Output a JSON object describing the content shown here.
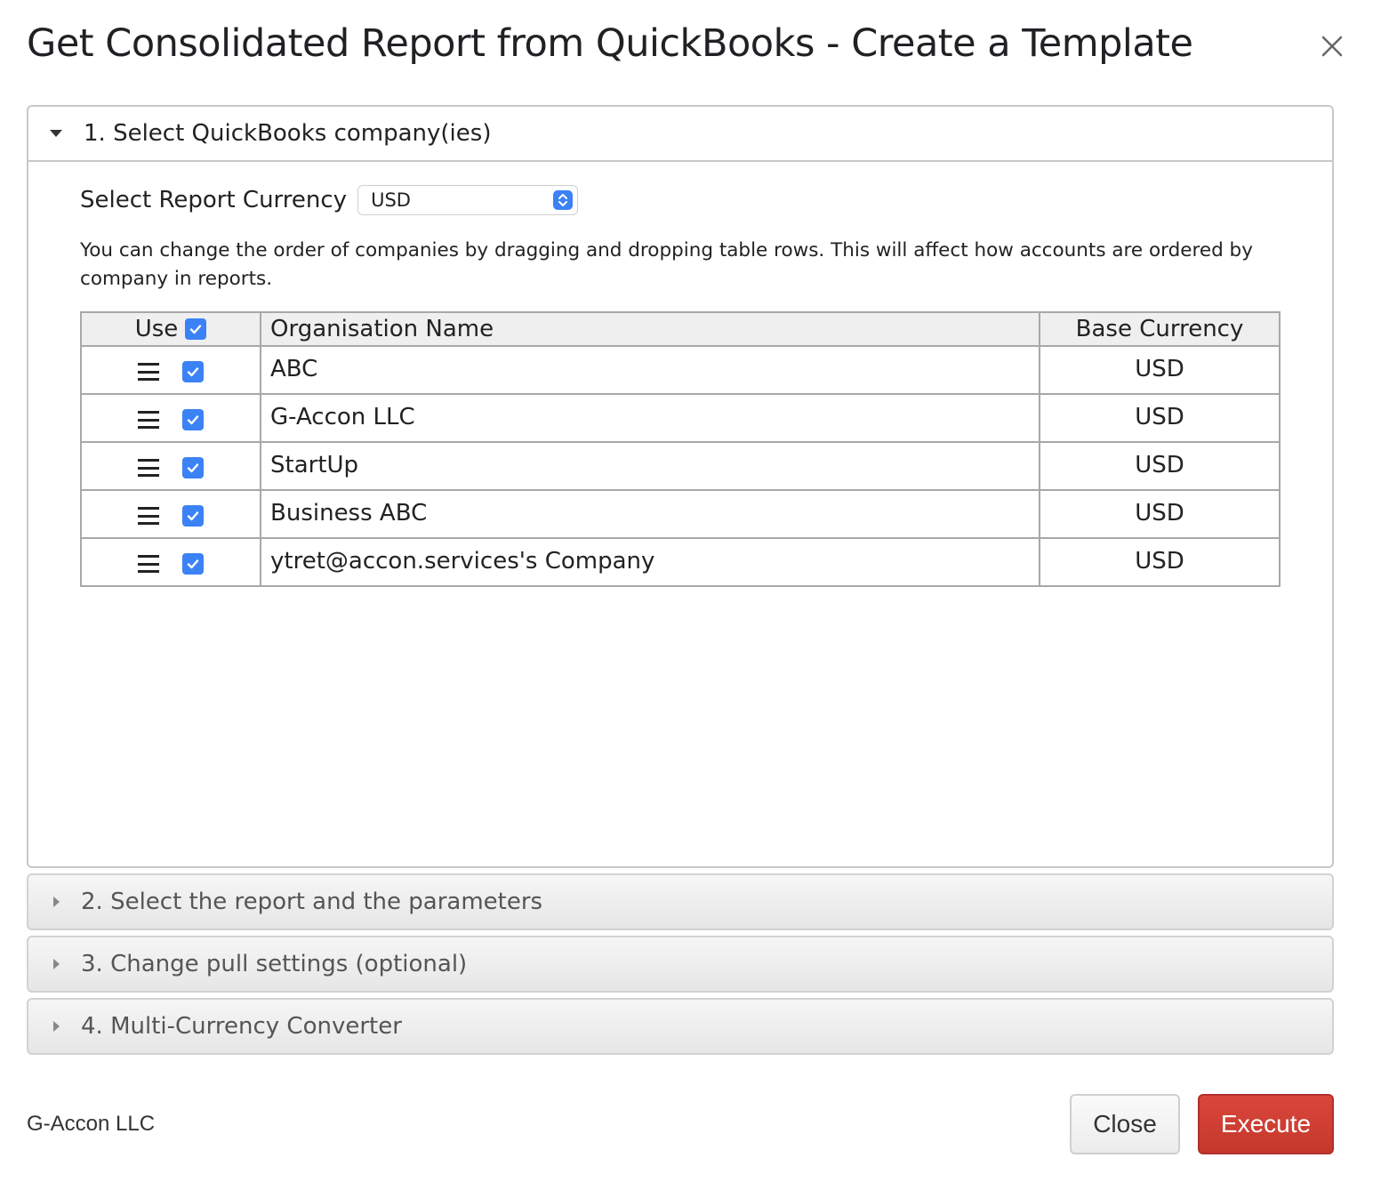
{
  "dialog": {
    "title": "Get Consolidated Report from QuickBooks - Create a Template",
    "close_icon": "close-icon"
  },
  "sections": [
    {
      "label": "1. Select QuickBooks company(ies)",
      "expanded": true
    },
    {
      "label": "2. Select the report and the parameters",
      "expanded": false
    },
    {
      "label": "3. Change pull settings (optional)",
      "expanded": false
    },
    {
      "label": "4. Multi-Currency Converter",
      "expanded": false
    }
  ],
  "currency": {
    "label": "Select Report Currency",
    "selected": "USD"
  },
  "help_text": "You can change the order of companies by dragging and dropping table rows. This will affect how accounts are ordered by company in reports.",
  "table": {
    "headers": {
      "use": "Use",
      "name": "Organisation Name",
      "base": "Base Currency"
    },
    "use_all_checked": true,
    "rows": [
      {
        "name": "ABC",
        "currency": "USD",
        "checked": true
      },
      {
        "name": "G-Accon LLC",
        "currency": "USD",
        "checked": true
      },
      {
        "name": "StartUp",
        "currency": "USD",
        "checked": true
      },
      {
        "name": "Business ABC",
        "currency": "USD",
        "checked": true
      },
      {
        "name": "ytret@accon.services's Company",
        "currency": "USD",
        "checked": true
      }
    ]
  },
  "footer": {
    "brand": "G-Accon LLC",
    "close_label": "Close",
    "execute_label": "Execute"
  },
  "colors": {
    "accent": "#3b82f6",
    "execute": "#c9392e"
  }
}
